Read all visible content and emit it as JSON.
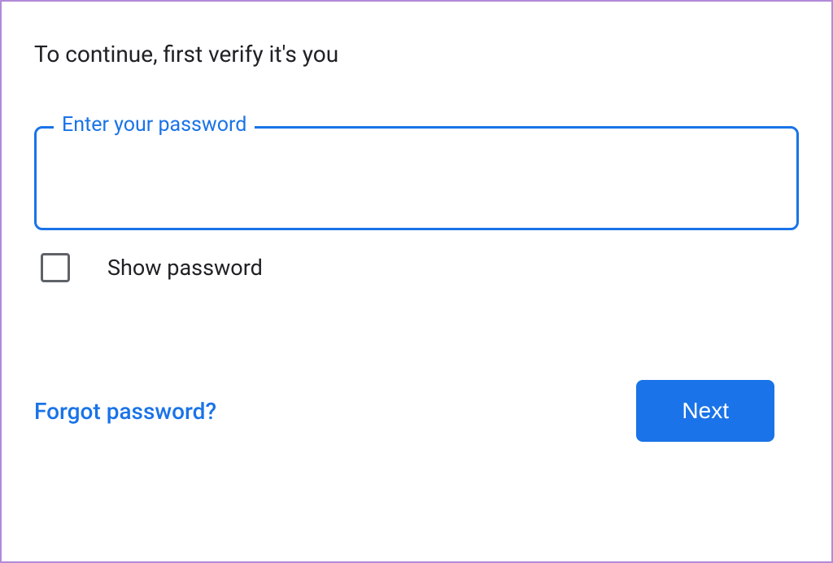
{
  "heading": "To continue, first verify it's you",
  "password": {
    "label": "Enter your password",
    "value": ""
  },
  "show_password": {
    "label": "Show password",
    "checked": false
  },
  "forgot_link": "Forgot password?",
  "next_button": "Next",
  "colors": {
    "accent": "#1a73e8",
    "border": "#b28bd8",
    "text": "#202124",
    "checkbox_border": "#5f6368"
  }
}
